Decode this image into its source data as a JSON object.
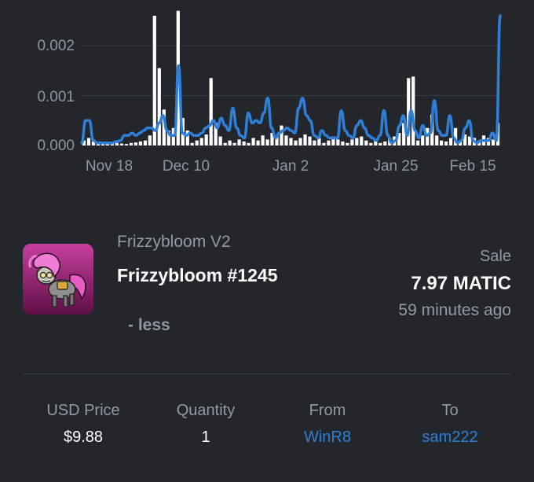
{
  "chart_data": {
    "type": "bar+line",
    "y_ticks": [
      "0.000",
      "0.001",
      "0.002"
    ],
    "ylim": [
      0,
      0.0026
    ],
    "x_ticks": [
      "Nov 18",
      "Dec 10",
      "Jan 2",
      "Jan 25",
      "Feb 15"
    ],
    "grid": true,
    "bar_color": "#ffffff",
    "line_color": "#2f7fd8",
    "bars": [
      0.0001,
      0.00015,
      8e-05,
      5e-05,
      4e-05,
      6e-05,
      3e-05,
      5e-05,
      4e-05,
      3e-05,
      5e-05,
      6e-05,
      8e-05,
      0.0001,
      0.0002,
      0.0026,
      0.00155,
      0.00072,
      0.0003,
      0.00035,
      0.0027,
      0.00055,
      0.0003,
      5e-05,
      0.0001,
      0.00015,
      0.00022,
      0.00135,
      0.00045,
      0.00018,
      5e-05,
      0.0001,
      5e-05,
      0.00012,
      8e-05,
      5e-05,
      0.00015,
      0.0001,
      0.0002,
      0.00012,
      0.00025,
      0.00018,
      0.0004,
      0.0002,
      0.00015,
      0.0001,
      0.00015,
      0.00022,
      0.00018,
      0.0001,
      0.00015,
      5e-05,
      0.0001,
      0.00018,
      0.00012,
      8e-05,
      5e-05,
      0.00012,
      0.00015,
      0.00018,
      0.0001,
      5e-05,
      0.00012,
      5e-05,
      8e-05,
      0.00015,
      0.00018,
      0.00025,
      0.00045,
      0.00135,
      0.00138,
      0.0001,
      0.0002,
      0.00035,
      0.00062,
      0.0002,
      0.0001,
      8e-05,
      0.00015,
      0.00035,
      0.0001,
      0.00022,
      0.00018,
      0.00015,
      0.0001,
      0.0002,
      0.00015,
      0.00012,
      0.00045
    ],
    "line": [
      5e-05,
      0.0005,
      0.0005,
      0.0001,
      5e-05,
      5e-05,
      5e-05,
      5e-05,
      5e-05,
      8e-05,
      0.0001,
      0.0002,
      0.0002,
      0.00025,
      0.0002,
      0.00025,
      0.0003,
      0.00035,
      0.00035,
      0.0003,
      0.00045,
      0.0006,
      0.0003,
      0.0002,
      0.0002,
      0.0016,
      0.00025,
      0.0002,
      0.00025,
      0.0002,
      0.0002,
      0.00025,
      0.00035,
      0.0004,
      0.0005,
      0.00035,
      0.00055,
      0.0004,
      0.0003,
      0.00075,
      0.00035,
      0.0002,
      0.00015,
      0.00065,
      0.00045,
      0.0005,
      0.00045,
      0.00065,
      0.00095,
      0.00035,
      0.00015,
      0.00025,
      0.0003,
      0.00035,
      0.0003,
      0.00025,
      0.00075,
      0.00095,
      0.0006,
      0.0005,
      0.0002,
      0.00015,
      0.0003,
      0.0002,
      0.00015,
      0.00015,
      0.00015,
      0.0007,
      0.0003,
      0.0002,
      0.00015,
      0.0004,
      0.0005,
      0.00035,
      0.0002,
      0.00015,
      0.0001,
      0.0002,
      0.0007,
      0.0002,
      5e-05,
      0.0001,
      0.0004,
      0.0006,
      0.0002,
      0.0007,
      0.0003,
      0.00015,
      0.0004,
      0.0002,
      0.00025,
      0.0009,
      0.0003,
      0.0002,
      0.0002,
      0.0006,
      0.00015,
      5e-05,
      0.0001,
      0.00035,
      0.0005,
      0.0001,
      5e-05,
      0.0001,
      0.0001,
      0.0001,
      0.00025,
      0.0001,
      0.0026
    ]
  },
  "nft": {
    "collection": "Frizzybloom V2",
    "title": "Frizzybloom #1245",
    "less_label": "- less",
    "thumbnail_icon": "pony-nft-thumbnail"
  },
  "sale": {
    "label": "Sale",
    "price": "7.97 MATIC",
    "time_ago": "59 minutes ago"
  },
  "stats": {
    "usd_price_label": "USD Price",
    "usd_price_value": "$9.88",
    "quantity_label": "Quantity",
    "quantity_value": "1",
    "from_label": "From",
    "from_value": "WinR8",
    "to_label": "To",
    "to_value": "sam222"
  },
  "colors": {
    "background": "#23272c",
    "accent": "#2f7fd8",
    "muted_text": "#939aa2"
  }
}
